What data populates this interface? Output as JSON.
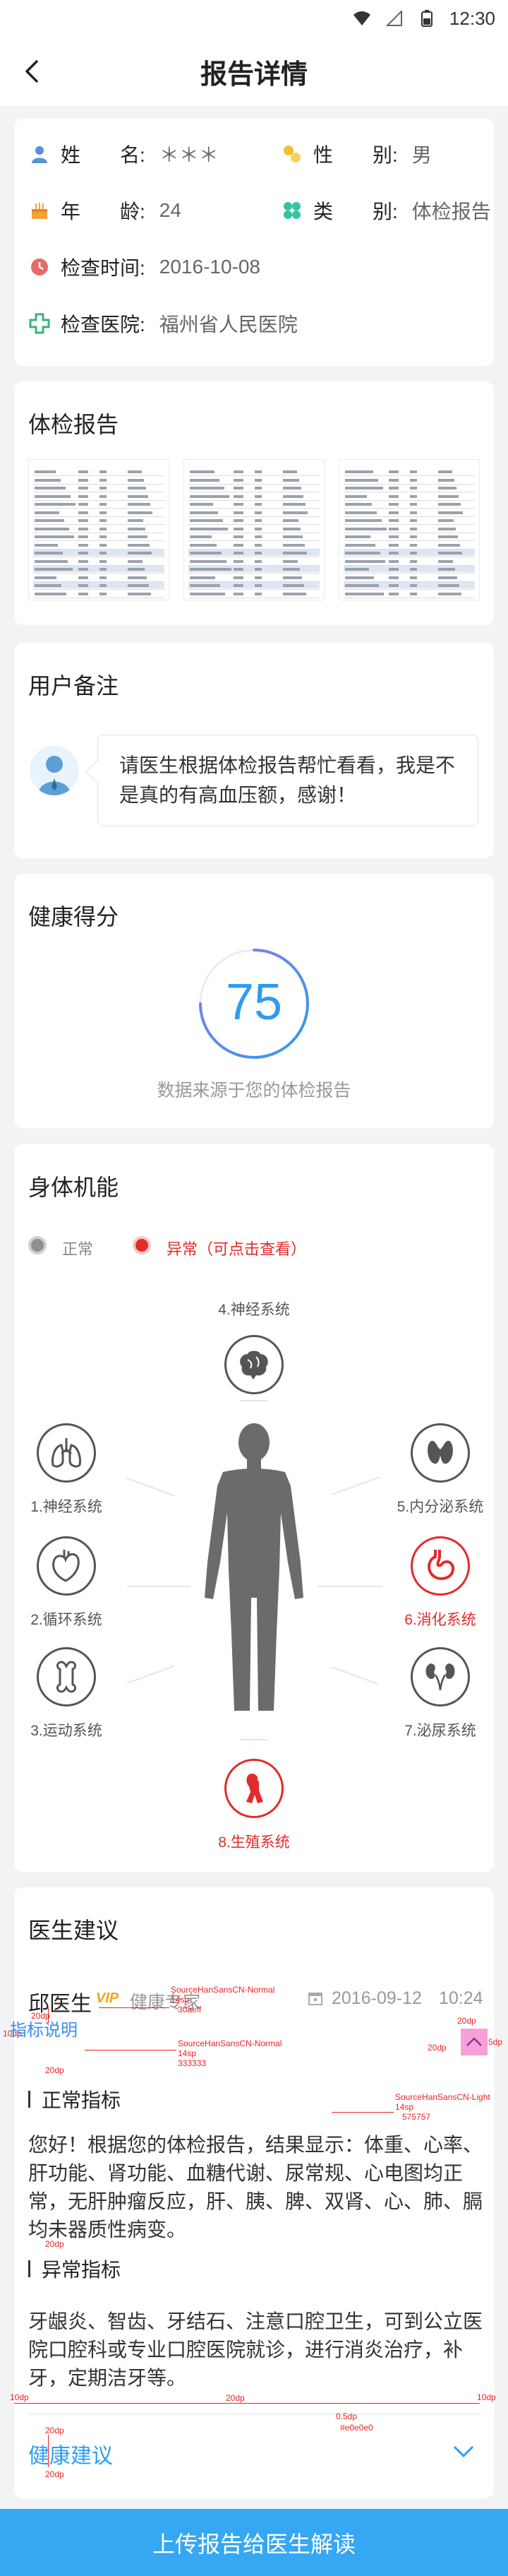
{
  "status_bar": {
    "time": "12:30"
  },
  "header": {
    "title": "报告详情"
  },
  "patient": {
    "name_label": "姓　　名:",
    "name_value": "＊＊＊",
    "gender_label": "性　　别:",
    "gender_value": "男",
    "age_label": "年　　龄:",
    "age_value": "24",
    "category_label": "类　　别:",
    "category_value": "体检报告",
    "date_label": "检查时间:",
    "date_value": "2016-10-08",
    "hospital_label": "检查医院:",
    "hospital_value": "福州省人民医院"
  },
  "report": {
    "title": "体检报告"
  },
  "remark": {
    "title": "用户备注",
    "text": "请医生根据体检报告帮忙看看，我是不是真的有高血压额，感谢！"
  },
  "score": {
    "title": "健康得分",
    "value": "75",
    "progress": 0.75,
    "subtitle": "数据来源于您的体检报告"
  },
  "body": {
    "title": "身体机能",
    "legend_normal": "正常",
    "legend_abnormal": "异常（可点击查看）",
    "colors": {
      "normal": "#555555",
      "abnormal": "#e22b2b",
      "figure": "#6b6b6b"
    },
    "systems": [
      {
        "label": "4.神经系统",
        "icon": "brain-icon",
        "abnormal": false
      },
      {
        "label": "1.神经系统",
        "icon": "lungs-icon",
        "abnormal": false
      },
      {
        "label": "2.循环系统",
        "icon": "heart-icon",
        "abnormal": false
      },
      {
        "label": "3.运动系统",
        "icon": "bone-icon",
        "abnormal": false
      },
      {
        "label": "5.内分泌系统",
        "icon": "thyroid-icon",
        "abnormal": false
      },
      {
        "label": "6.消化系统",
        "icon": "stomach-icon",
        "abnormal": true
      },
      {
        "label": "7.泌尿系统",
        "icon": "kidney-icon",
        "abnormal": false
      },
      {
        "label": "8.生殖系统",
        "icon": "reproductive-icon",
        "abnormal": true
      }
    ]
  },
  "advice": {
    "title": "医生建议",
    "doctor_name": "邱医生",
    "vip": "VIP",
    "doctor_title": "健康专家",
    "date": "2016-09-12",
    "time": "10:24",
    "normal_head": "正常指标",
    "normal_text": "您好！根据您的体检报告，结果显示：体重、心率、肝功能、肾功能、血糖代谢、尿常规、心电图均正常，无肝肿瘤反应，肝、胰、脾、双肾、心、肺、膈均未器质性病变。",
    "abnormal_head": "异常指标",
    "abnormal_text": "牙龈炎、智齿、牙结石、注意口腔卫生，可到公立医院口腔科或专业口腔医院就诊，进行消炎治疗，补牙，定期洁牙等。",
    "health_link": "健康建议"
  },
  "annotations": {
    "indicator": "指标说明",
    "spec1_font": "SourceHanSansCN-Normal",
    "spec1_size": "14sp",
    "spec1_color": "30aeff",
    "spec2_font": "SourceHanSansCN-Normal",
    "spec2_size": "14sp",
    "spec2_color": "333333",
    "spec3_font": "SourceHanSansCN-Light",
    "spec3_size": "14sp",
    "spec3_color": "575757",
    "spacing_20": "20dp",
    "spacing_10": "10dp",
    "spacing_5": "5dp",
    "divider": "0.5dp",
    "divider_color": "#e0e0e0"
  },
  "bottom": {
    "button": "上传报告给医生解读"
  }
}
